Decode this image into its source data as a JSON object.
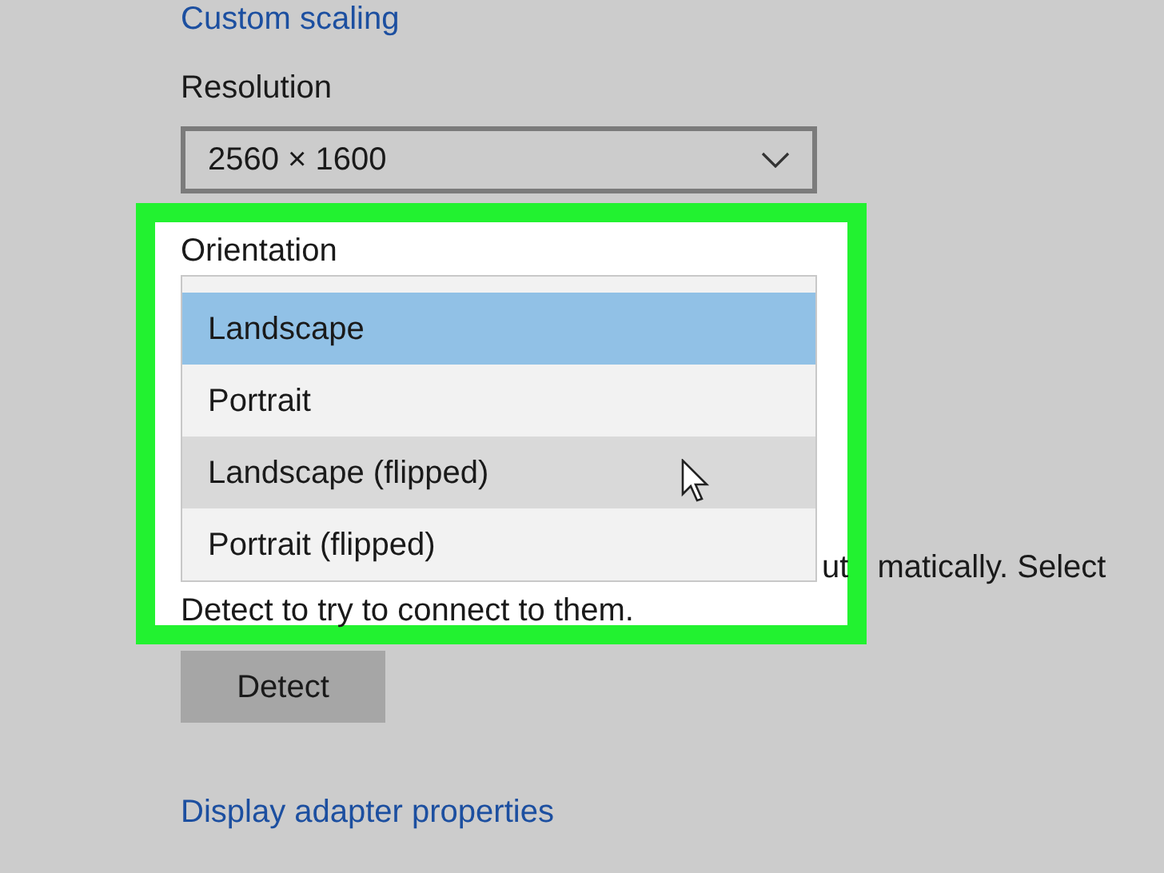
{
  "custom_scaling_link": "Custom scaling",
  "resolution": {
    "label": "Resolution",
    "value": "2560 × 1600"
  },
  "detect_note": {
    "line_1_parts": [
      "ut",
      "matically. Select"
    ],
    "line_2": "Detect to try to connect to them."
  },
  "detect_button": "Detect",
  "adapter_link": "Display adapter properties",
  "orientation": {
    "label": "Orientation",
    "options": [
      {
        "label": "Landscape",
        "selected": true,
        "hovered": false
      },
      {
        "label": "Portrait",
        "selected": false,
        "hovered": false
      },
      {
        "label": "Landscape (flipped)",
        "selected": false,
        "hovered": true
      },
      {
        "label": "Portrait (flipped)",
        "selected": false,
        "hovered": false
      }
    ]
  }
}
